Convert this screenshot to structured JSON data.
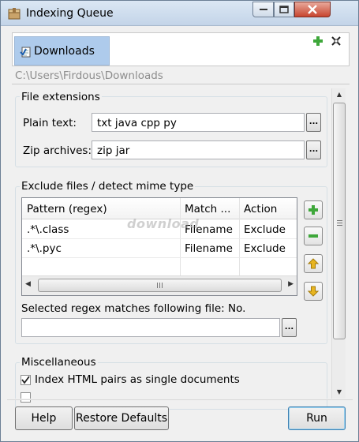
{
  "window": {
    "title": "Indexing Queue"
  },
  "tabs": [
    {
      "label": "Downloads"
    }
  ],
  "path": "C:\\Users\\Firdous\\Downloads",
  "file_extensions": {
    "title": "File extensions",
    "plain_text_label": "Plain text:",
    "plain_text_value": "txt java cpp py",
    "zip_label": "Zip archives:",
    "zip_value": "zip jar",
    "browse_label": "..."
  },
  "exclude": {
    "title": "Exclude files / detect mime type",
    "columns": [
      "Pattern (regex)",
      "Match ...",
      "Action"
    ],
    "rows": [
      {
        "pattern": ".*\\.class",
        "match": "Filename",
        "action": "Exclude"
      },
      {
        "pattern": ".*\\.pyc",
        "match": "Filename",
        "action": "Exclude"
      }
    ],
    "status": "Selected regex matches following file: No.",
    "test_value": "",
    "browse_label": "..."
  },
  "misc": {
    "title": "Miscellaneous",
    "index_html_label": "Index HTML pairs as single documents",
    "index_html_checked": true,
    "second_option_checked": false
  },
  "watermark": "download",
  "buttons": {
    "help": "Help",
    "restore": "Restore Defaults",
    "run": "Run"
  },
  "colors": {
    "tab_selected": "#aecbec",
    "add_green": "#3ea73a",
    "arrow_yellow": "#e8b520"
  }
}
